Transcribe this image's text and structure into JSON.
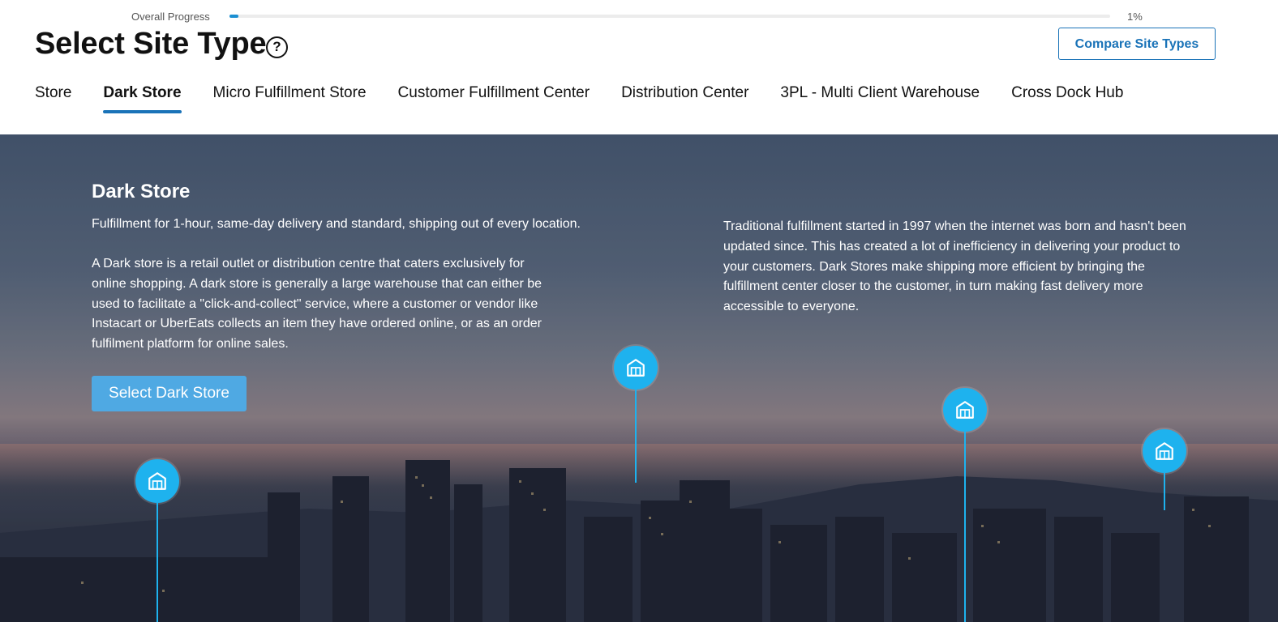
{
  "progress": {
    "label": "Overall Progress",
    "percent_text": "1%",
    "value": 0.01
  },
  "header": {
    "title": "Select Site Type",
    "help_icon": "question-circle-icon",
    "compare_button": "Compare Site Types"
  },
  "tabs": [
    {
      "label": "Store",
      "active": false
    },
    {
      "label": "Dark Store",
      "active": true
    },
    {
      "label": "Micro Fulfillment Store",
      "active": false
    },
    {
      "label": "Customer Fulfillment Center",
      "active": false
    },
    {
      "label": "Distribution Center",
      "active": false
    },
    {
      "label": "3PL - Multi Client Warehouse",
      "active": false
    },
    {
      "label": "Cross Dock Hub",
      "active": false
    }
  ],
  "hero": {
    "title": "Dark Store",
    "tagline": "Fulfillment for 1-hour, same-day delivery and standard, shipping out of every location.",
    "description": "A Dark store is a retail outlet or distribution centre that caters exclusively for online shopping. A dark store is generally a large warehouse that can either be used to facilitate a \"click-and-collect\" service, where a customer or vendor like Instacart or UberEats collects an item they have ordered online, or as an order fulfilment platform for online sales.",
    "right_text": "Traditional fulfillment started in 1997 when the internet was born and hasn't been updated since. This has created a lot of inefficiency in delivering your product to your customers. Dark Stores make shipping more efficient by bringing the fulfillment center closer to the customer, in turn making fast delivery more accessible to everyone.",
    "select_button": "Select Dark Store",
    "pin_icon": "warehouse-icon"
  },
  "colors": {
    "accent": "#1a73b8",
    "pin": "#1eb2ee",
    "select_button": "#4fa9e3"
  }
}
